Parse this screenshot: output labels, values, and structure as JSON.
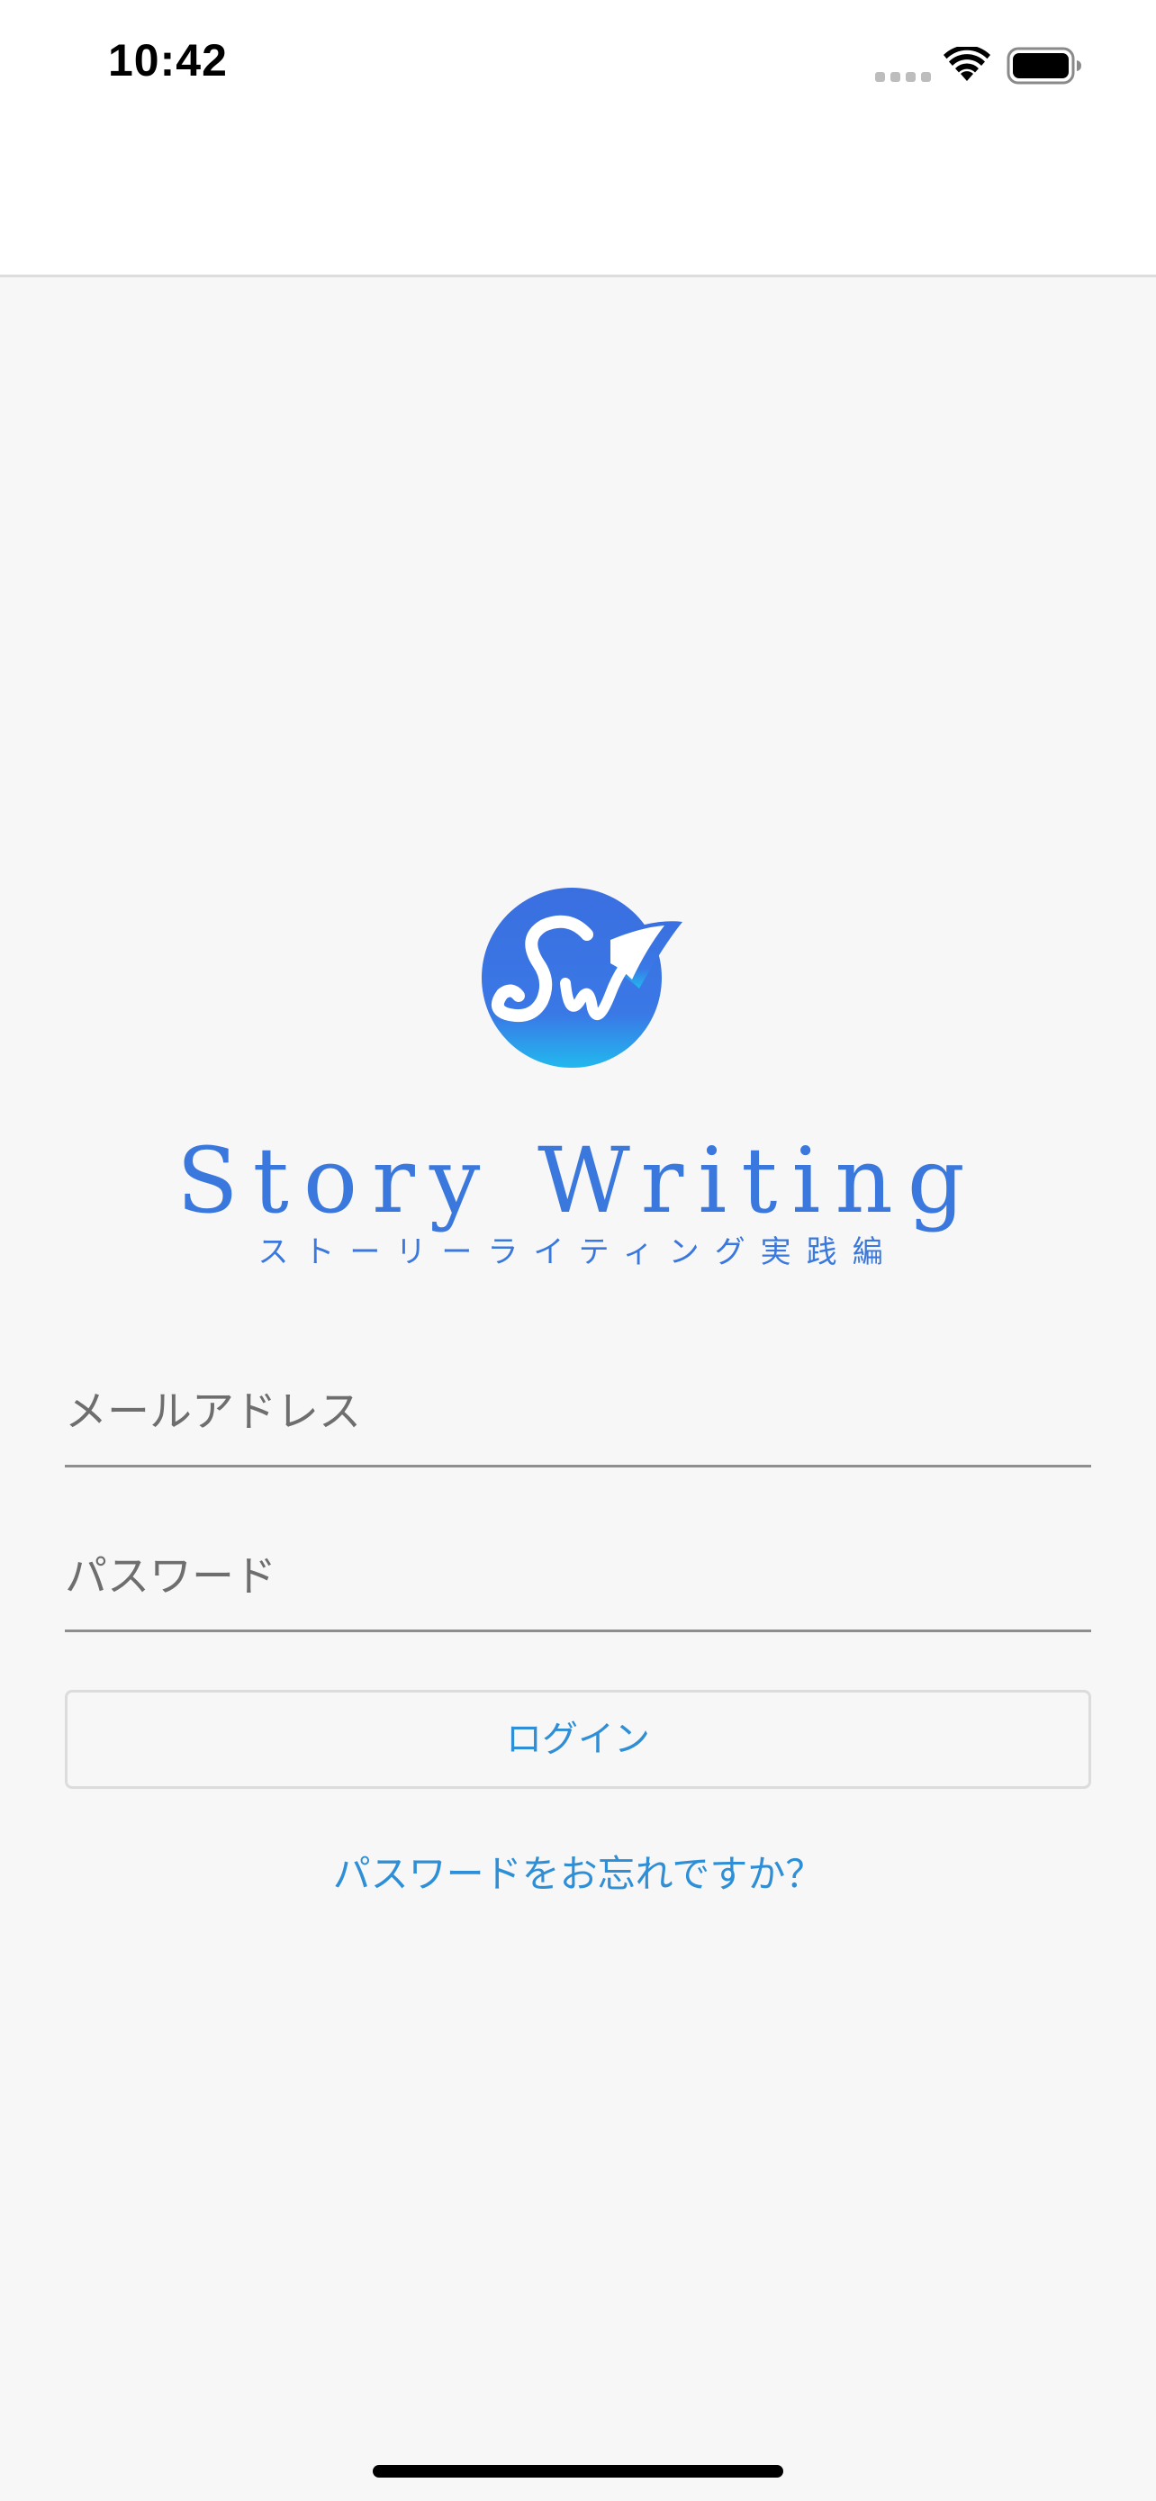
{
  "status_bar": {
    "time": "10:42"
  },
  "logo": {
    "title": "Story Writing",
    "subtitle": "ストーリーライティング実践編",
    "brand_color": "#3a78de"
  },
  "form": {
    "email_placeholder": "メールアドレス",
    "email_value": "",
    "password_placeholder": "パスワード",
    "password_value": "",
    "login_label": "ログイン",
    "forgot_password_label": "パスワードをお忘れですか？"
  },
  "colors": {
    "accent": "#2f8fd6",
    "background": "#f7f7f7",
    "header": "#ffffff"
  }
}
